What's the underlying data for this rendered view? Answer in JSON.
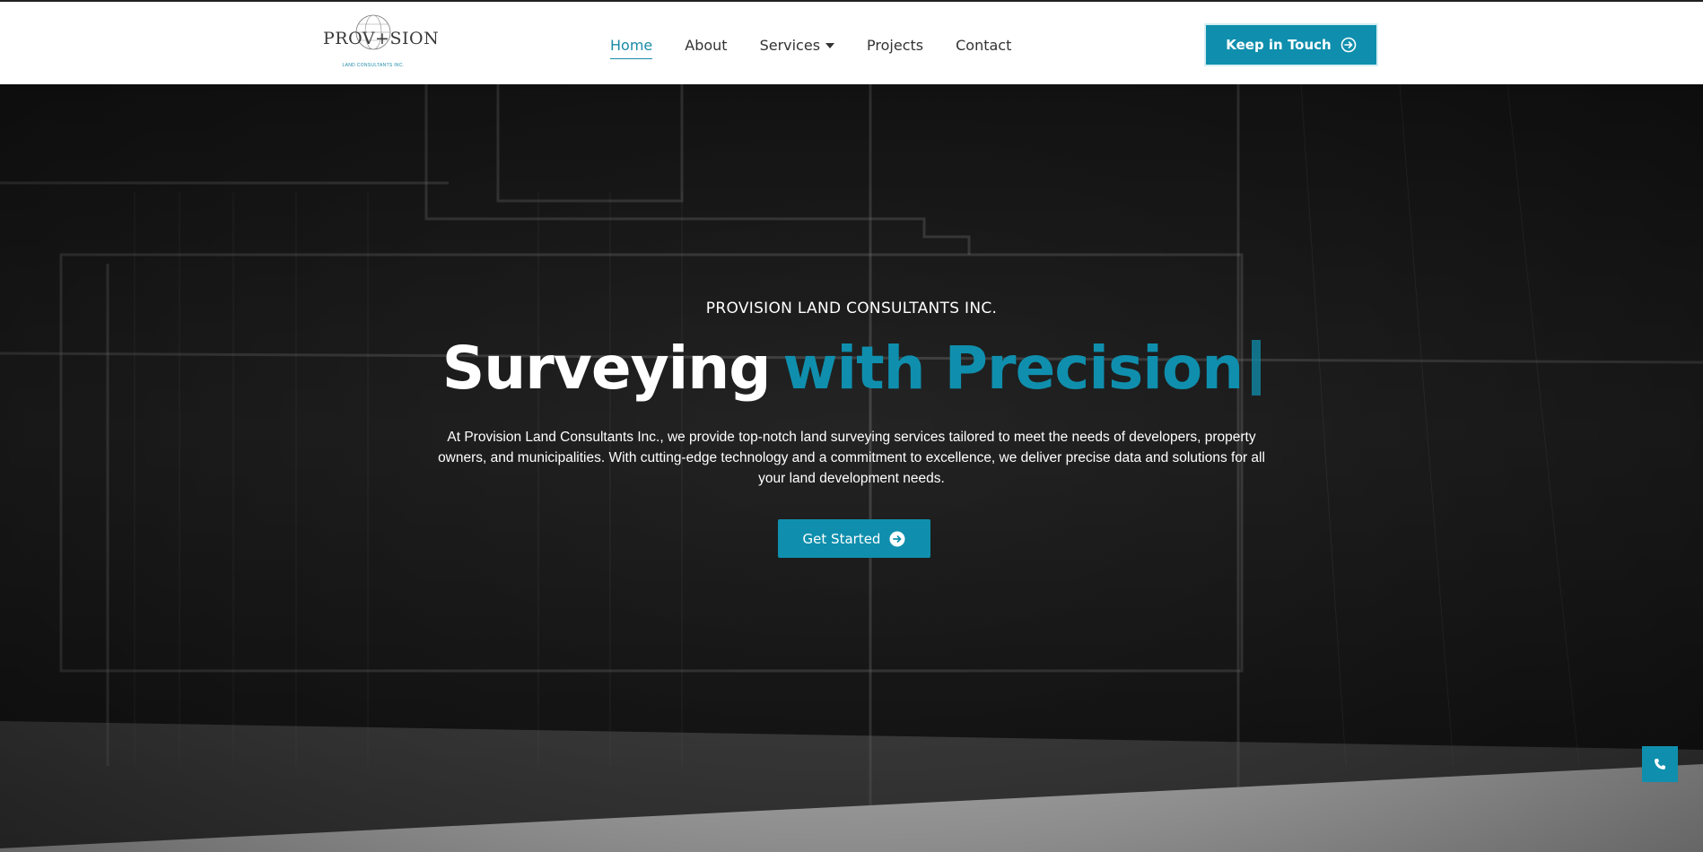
{
  "brand": {
    "logo_text": "PROV+SION",
    "logo_subtext": "LAND CONSULTANTS INC."
  },
  "nav": {
    "items": [
      {
        "label": "Home",
        "active": true
      },
      {
        "label": "About"
      },
      {
        "label": "Services",
        "has_dropdown": true
      },
      {
        "label": "Projects"
      },
      {
        "label": "Contact"
      }
    ]
  },
  "header_cta": {
    "label": "Keep in Touch",
    "icon": "arrow-circle-right-icon"
  },
  "hero": {
    "eyebrow": "PROVISION LAND CONSULTANTS INC.",
    "headline_part1": "Surveying",
    "headline_part2": "with Precision",
    "description": "At Provision Land Consultants Inc., we provide top-notch land surveying services tailored to meet the needs of developers, property owners, and municipalities. With cutting-edge technology and a commitment to excellence, we deliver precise data and solutions for all your land development needs.",
    "cta_label": "Get Started",
    "cta_icon": "arrow-circle-right-icon"
  },
  "floating": {
    "icon": "phone-icon"
  },
  "colors": {
    "accent": "#0f8fad",
    "text_dark": "#333333",
    "hero_bg": "#1e1e1e",
    "white": "#ffffff"
  }
}
